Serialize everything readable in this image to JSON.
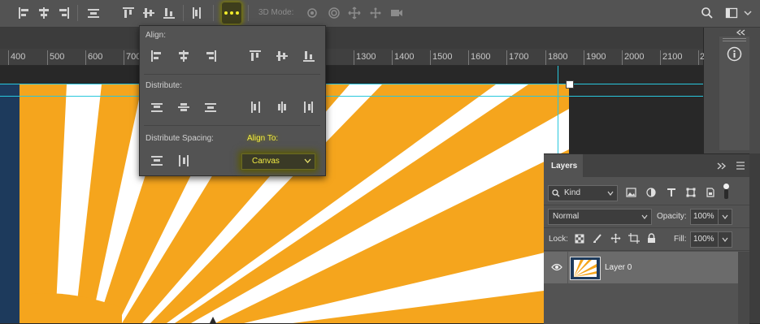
{
  "options_bar": {
    "mode_3d_label": "3D Mode:"
  },
  "ruler": {
    "labels": [
      "400",
      "500",
      "600",
      "700",
      "1300",
      "1400",
      "1500",
      "1600",
      "1700",
      "1800",
      "1900",
      "2000",
      "2100",
      "2"
    ]
  },
  "align_popup": {
    "align_label": "Align:",
    "distribute_label": "Distribute:",
    "distribute_spacing_label": "Distribute Spacing:",
    "align_to_label": "Align To:",
    "align_to_value": "Canvas"
  },
  "layers_panel": {
    "tab_label": "Layers",
    "filter_kind": "Kind",
    "blend_mode": "Normal",
    "opacity_label": "Opacity:",
    "opacity_value": "100%",
    "lock_label": "Lock:",
    "fill_label": "Fill:",
    "fill_value": "100%",
    "layers": [
      {
        "name": "Layer 0",
        "visible": true
      }
    ]
  },
  "colors": {
    "accent_highlight": "#f2ec2b",
    "sunburst_orange": "#f5a51d",
    "canvas_navy": "#1d3a5c",
    "guide_cyan": "#29c7dd"
  }
}
